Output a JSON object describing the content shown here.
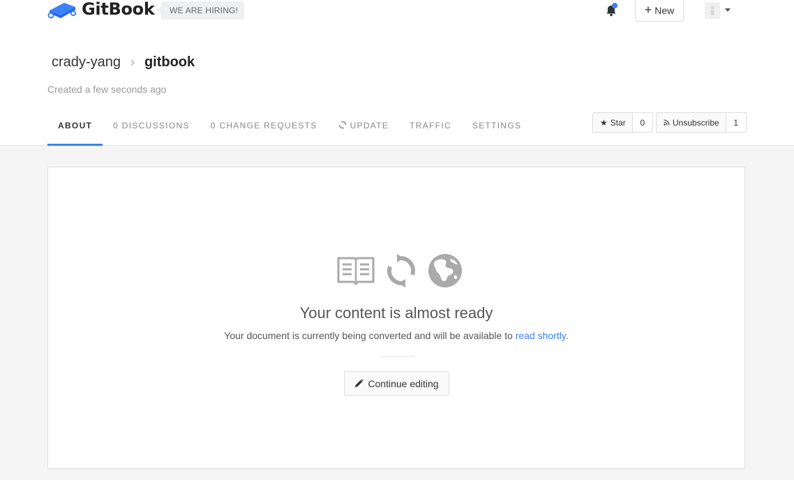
{
  "header": {
    "logo_text": "GitBook",
    "hiring_label": "WE ARE HIRING!",
    "new_label": "New",
    "notification_color": "#3b82f6"
  },
  "breadcrumb": {
    "owner": "crady-yang",
    "repo": "gitbook"
  },
  "created_text": "Created a few seconds ago",
  "tabs": [
    {
      "label": "ABOUT",
      "active": true
    },
    {
      "label": "0 DISCUSSIONS",
      "active": false
    },
    {
      "label": "0 CHANGE REQUESTS",
      "active": false
    },
    {
      "label": "UPDATE",
      "active": false,
      "icon": "refresh-icon"
    },
    {
      "label": "TRAFFIC",
      "active": false
    },
    {
      "label": "SETTINGS",
      "active": false
    }
  ],
  "actions": {
    "star_label": "Star",
    "star_count": "0",
    "unsubscribe_label": "Unsubscribe",
    "unsubscribe_count": "1"
  },
  "content": {
    "icons": [
      "book-icon",
      "refresh-icon",
      "globe-icon"
    ],
    "title": "Your content is almost ready",
    "desc_prefix": "Your document is currently being converted and will be available to ",
    "desc_link": "read shortly",
    "desc_suffix": ".",
    "button_label": "Continue editing"
  },
  "colors": {
    "accent": "#3b82f6",
    "icon_gray": "#aaaaaa"
  }
}
